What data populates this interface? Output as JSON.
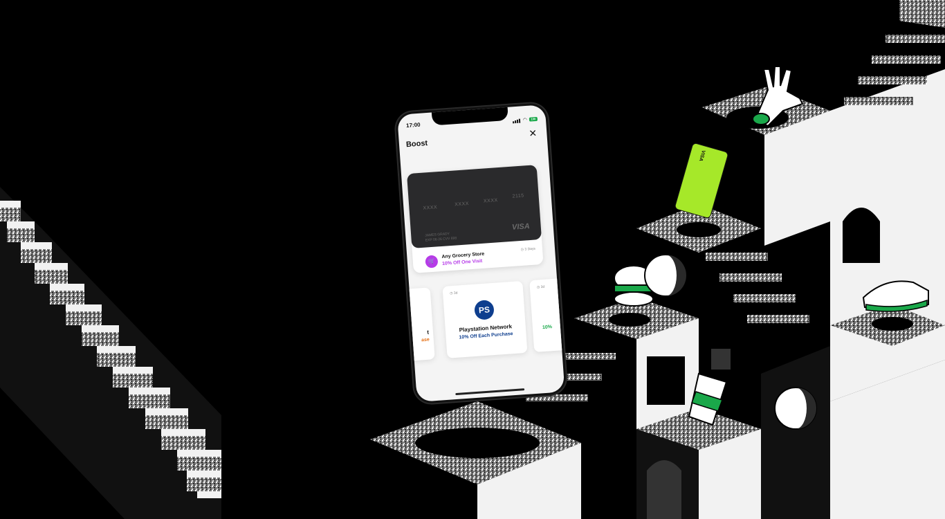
{
  "phone": {
    "time": "17:00",
    "battery": "100",
    "title": "Boost",
    "close_glyph": "✕"
  },
  "card": {
    "groups": [
      "XXXX",
      "XXXX",
      "XXXX",
      "2115"
    ],
    "holder": "JAMES GRADY",
    "expiry": "EXP 06-26  CVV 698",
    "network": "VISA"
  },
  "featured_offer": {
    "merchant": "Any Grocery Store",
    "offer": "10% Off One Visit",
    "days": "3 Days",
    "icon": "cart-icon"
  },
  "tiles": [
    {
      "merchant": "t",
      "offer": "ase",
      "days": "",
      "offer_color": "#e6731a"
    },
    {
      "merchant": "Playstation Network",
      "offer": "10% Off Each Purchase",
      "days": "3d",
      "offer_color": "#0e3e8e",
      "icon": "playstation-icon"
    },
    {
      "merchant": "",
      "offer": "10%",
      "days": "3d",
      "offer_color": "#1aa84a"
    }
  ],
  "colors": {
    "background": "#000000",
    "accent_purple": "#b63be8",
    "lime": "#a6e829",
    "green": "#1aa84a"
  },
  "illustration": {
    "green_card_label": "VISA"
  }
}
